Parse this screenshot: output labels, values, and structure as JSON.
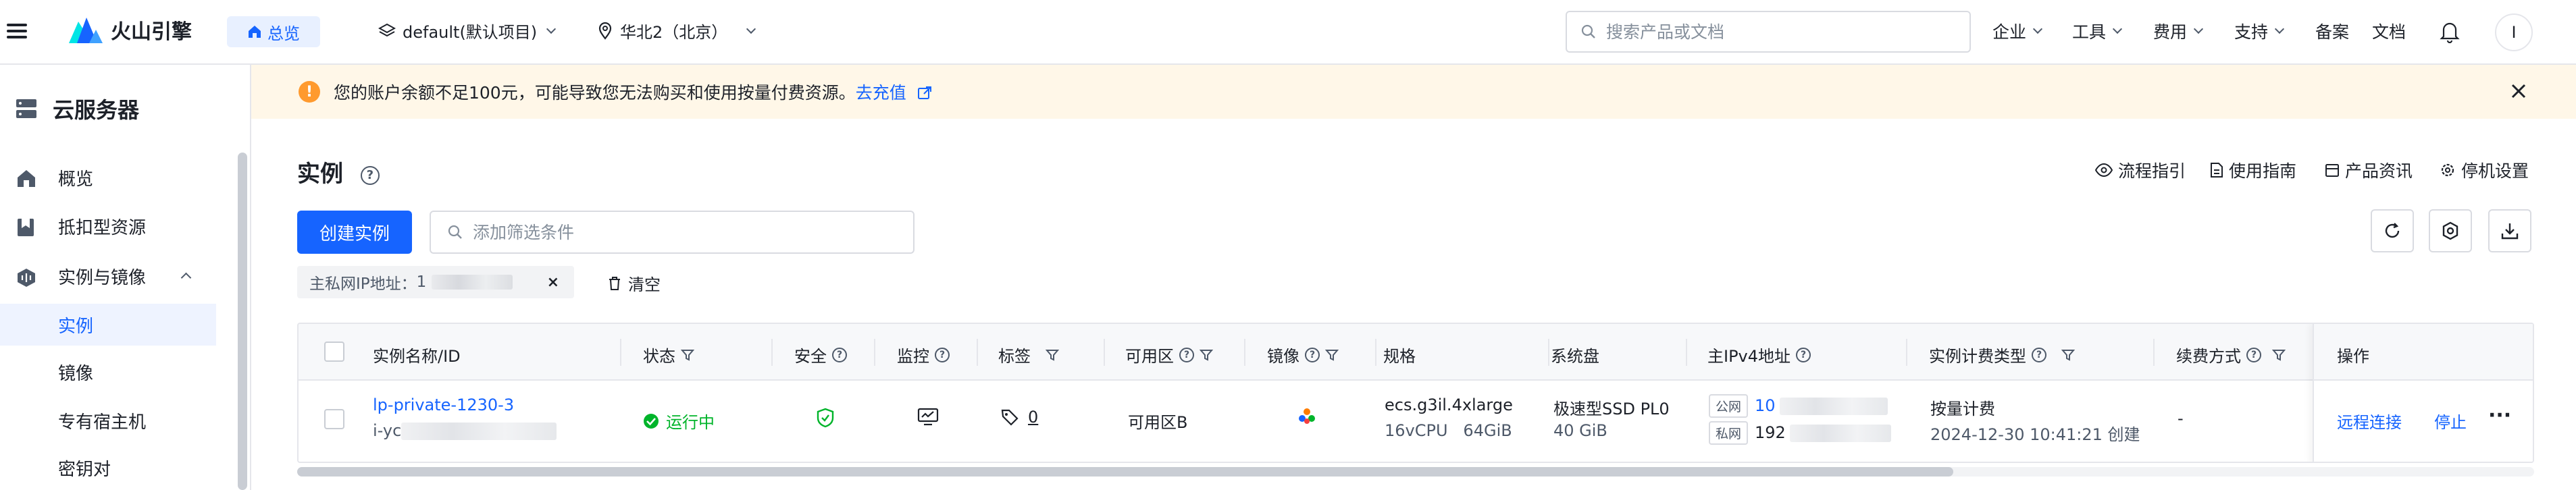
{
  "header": {
    "brand": "火山引擎",
    "home_label": "总览",
    "project_label": "default(默认项目)",
    "region_label": "华北2（北京）",
    "search_placeholder": "搜索产品或文档",
    "nav": [
      "企业",
      "工具",
      "费用",
      "支持",
      "备案",
      "文档"
    ],
    "avatar_letter": "I"
  },
  "sidebar": {
    "title": "云服务器",
    "items": [
      {
        "label": "概览"
      },
      {
        "label": "抵扣型资源"
      },
      {
        "label": "实例与镜像"
      },
      {
        "label": "实例"
      },
      {
        "label": "镜像"
      },
      {
        "label": "专有宿主机"
      },
      {
        "label": "密钥对"
      }
    ]
  },
  "banner": {
    "text": "您的账户余额不足100元，可能导致您无法购买和使用按量付费资源。",
    "link": "去充值"
  },
  "main": {
    "title": "实例",
    "links": [
      "流程指引",
      "使用指南",
      "产品资讯",
      "停机设置"
    ],
    "create_button": "创建实例",
    "filter_placeholder": "添加筛选条件",
    "chip_label": "主私网IP地址：",
    "chip_prefix": "1",
    "clear_label": "清空"
  },
  "table": {
    "headers": [
      "实例名称/ID",
      "状态",
      "安全",
      "监控",
      "标签",
      "可用区",
      "镜像",
      "规格",
      "系统盘",
      "主IPv4地址",
      "实例计费类型",
      "续费方式",
      "操作"
    ],
    "row": {
      "name": "lp-private-1230-3",
      "id_prefix": "i-yc",
      "status": "运行中",
      "tag_count": "0",
      "zone": "可用区B",
      "spec_name": "ecs.g3il.4xlarge",
      "spec_detail": "16vCPU   64GiB",
      "disk_type": "极速型SSD PL0",
      "disk_size": "40 GiB",
      "ip_public_tag": "公网",
      "ip_public_prefix": "10",
      "ip_private_tag": "私网",
      "ip_private_prefix": "192",
      "billing": "按量计费",
      "created": "2024-12-30 10:41:21 创建",
      "renew": "-",
      "action_connect": "远程连接",
      "action_stop": "停止",
      "action_more": "···"
    }
  },
  "colors": {
    "primary": "#1664ff",
    "success": "#00b42a",
    "warning": "#ff9a2e",
    "banner_bg": "#fff7e8"
  }
}
